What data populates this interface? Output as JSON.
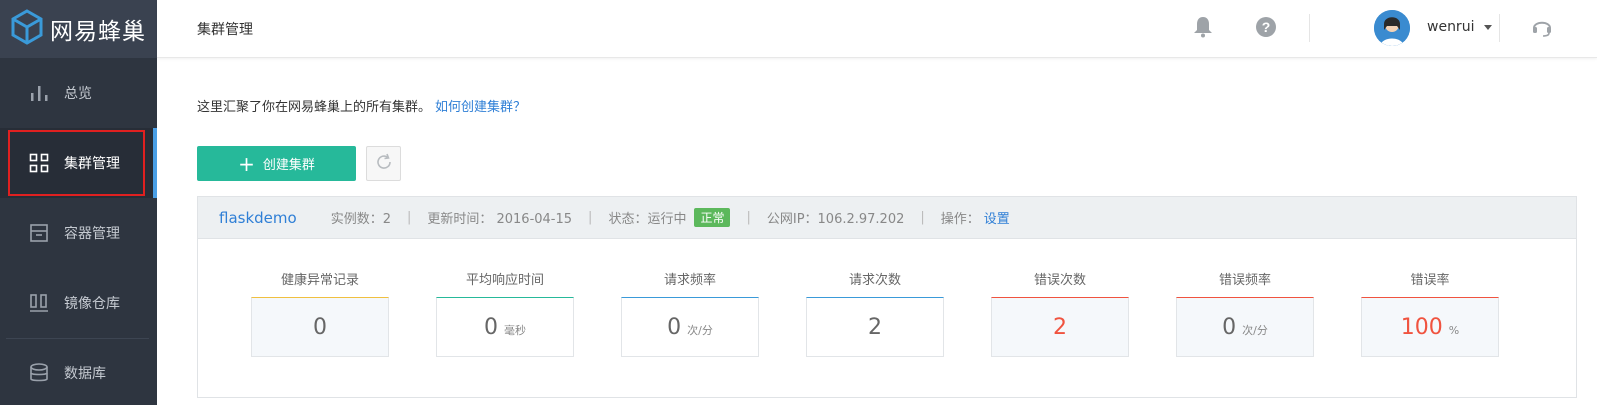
{
  "brand": {
    "name": "网易蜂巢"
  },
  "sidebar": {
    "items": [
      {
        "label": "总览",
        "icon": "bar-chart-icon"
      },
      {
        "label": "集群管理",
        "icon": "grid-icon",
        "active": true
      },
      {
        "label": "容器管理",
        "icon": "archive-box-icon"
      },
      {
        "label": "镜像仓库",
        "icon": "columns-icon"
      },
      {
        "label": "数据库",
        "icon": "database-icon"
      }
    ]
  },
  "header": {
    "breadcrumb": "集群管理",
    "username": "wenrui"
  },
  "main": {
    "intro_text": "这里汇聚了你在网易蜂巢上的所有集群。",
    "intro_link": "如何创建集群？",
    "create_button": "创建集群"
  },
  "cluster": {
    "name": "flaskdemo",
    "instances": "实例数：2",
    "updated": "更新时间： 2016-04-15",
    "status_label": "状态：运行中",
    "status_badge": "正常",
    "public_ip": "公网IP：106.2.97.202",
    "ops_label": "操作：",
    "ops_link": "设置",
    "separator": "|"
  },
  "metrics": [
    {
      "label": "健康异常记录",
      "value": "0",
      "unit": "",
      "color": "#f0c040"
    },
    {
      "label": "平均响应时间",
      "value": "0",
      "unit": "毫秒",
      "color": "#26b99a"
    },
    {
      "label": "请求频率",
      "value": "0",
      "unit": "次/分",
      "color": "#3a9ad9"
    },
    {
      "label": "请求次数",
      "value": "2",
      "unit": "",
      "color": "#3a9ad9"
    },
    {
      "label": "错误次数",
      "value": "2",
      "unit": "",
      "color": "#f0533f"
    },
    {
      "label": "错误频率",
      "value": "0",
      "unit": "次/分",
      "color": "#f0533f"
    },
    {
      "label": "错误率",
      "value": "100",
      "unit": "%",
      "color": "#f0533f"
    }
  ],
  "colors": {
    "accent": "#26b99a",
    "link": "#2f7fd6",
    "sidebar_bg": "#2e3540",
    "error": "#f0533f"
  }
}
